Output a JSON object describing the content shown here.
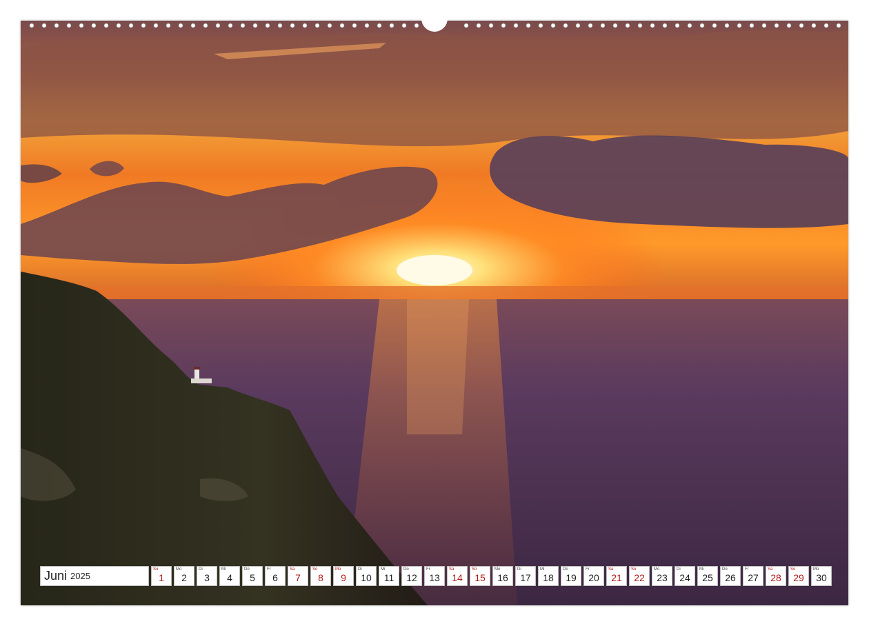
{
  "calendar": {
    "month": "Juni",
    "year": "2025",
    "days": [
      {
        "abbr": "So",
        "num": "1",
        "weekend": true
      },
      {
        "abbr": "Mo",
        "num": "2",
        "weekend": false
      },
      {
        "abbr": "Di",
        "num": "3",
        "weekend": false
      },
      {
        "abbr": "Mi",
        "num": "4",
        "weekend": false
      },
      {
        "abbr": "Do",
        "num": "5",
        "weekend": false
      },
      {
        "abbr": "Fr",
        "num": "6",
        "weekend": false
      },
      {
        "abbr": "Sa",
        "num": "7",
        "weekend": true
      },
      {
        "abbr": "So",
        "num": "8",
        "weekend": true
      },
      {
        "abbr": "Mo",
        "num": "9",
        "weekend": true
      },
      {
        "abbr": "Di",
        "num": "10",
        "weekend": false
      },
      {
        "abbr": "Mi",
        "num": "11",
        "weekend": false
      },
      {
        "abbr": "Do",
        "num": "12",
        "weekend": false
      },
      {
        "abbr": "Fr",
        "num": "13",
        "weekend": false
      },
      {
        "abbr": "Sa",
        "num": "14",
        "weekend": true
      },
      {
        "abbr": "So",
        "num": "15",
        "weekend": true
      },
      {
        "abbr": "Mo",
        "num": "16",
        "weekend": false
      },
      {
        "abbr": "Di",
        "num": "17",
        "weekend": false
      },
      {
        "abbr": "Mi",
        "num": "18",
        "weekend": false
      },
      {
        "abbr": "Do",
        "num": "19",
        "weekend": false
      },
      {
        "abbr": "Fr",
        "num": "20",
        "weekend": false
      },
      {
        "abbr": "Sa",
        "num": "21",
        "weekend": true
      },
      {
        "abbr": "So",
        "num": "22",
        "weekend": true
      },
      {
        "abbr": "Mo",
        "num": "23",
        "weekend": false
      },
      {
        "abbr": "Di",
        "num": "24",
        "weekend": false
      },
      {
        "abbr": "Mi",
        "num": "25",
        "weekend": false
      },
      {
        "abbr": "Do",
        "num": "26",
        "weekend": false
      },
      {
        "abbr": "Fr",
        "num": "27",
        "weekend": false
      },
      {
        "abbr": "Sa",
        "num": "28",
        "weekend": true
      },
      {
        "abbr": "So",
        "num": "29",
        "weekend": true
      },
      {
        "abbr": "Mo",
        "num": "30",
        "weekend": false
      }
    ]
  },
  "colors": {
    "weekend": "#b01a1a",
    "sun": "#fff6c8",
    "sea": "#4a2f55",
    "cliff": "#2b2a1c"
  }
}
